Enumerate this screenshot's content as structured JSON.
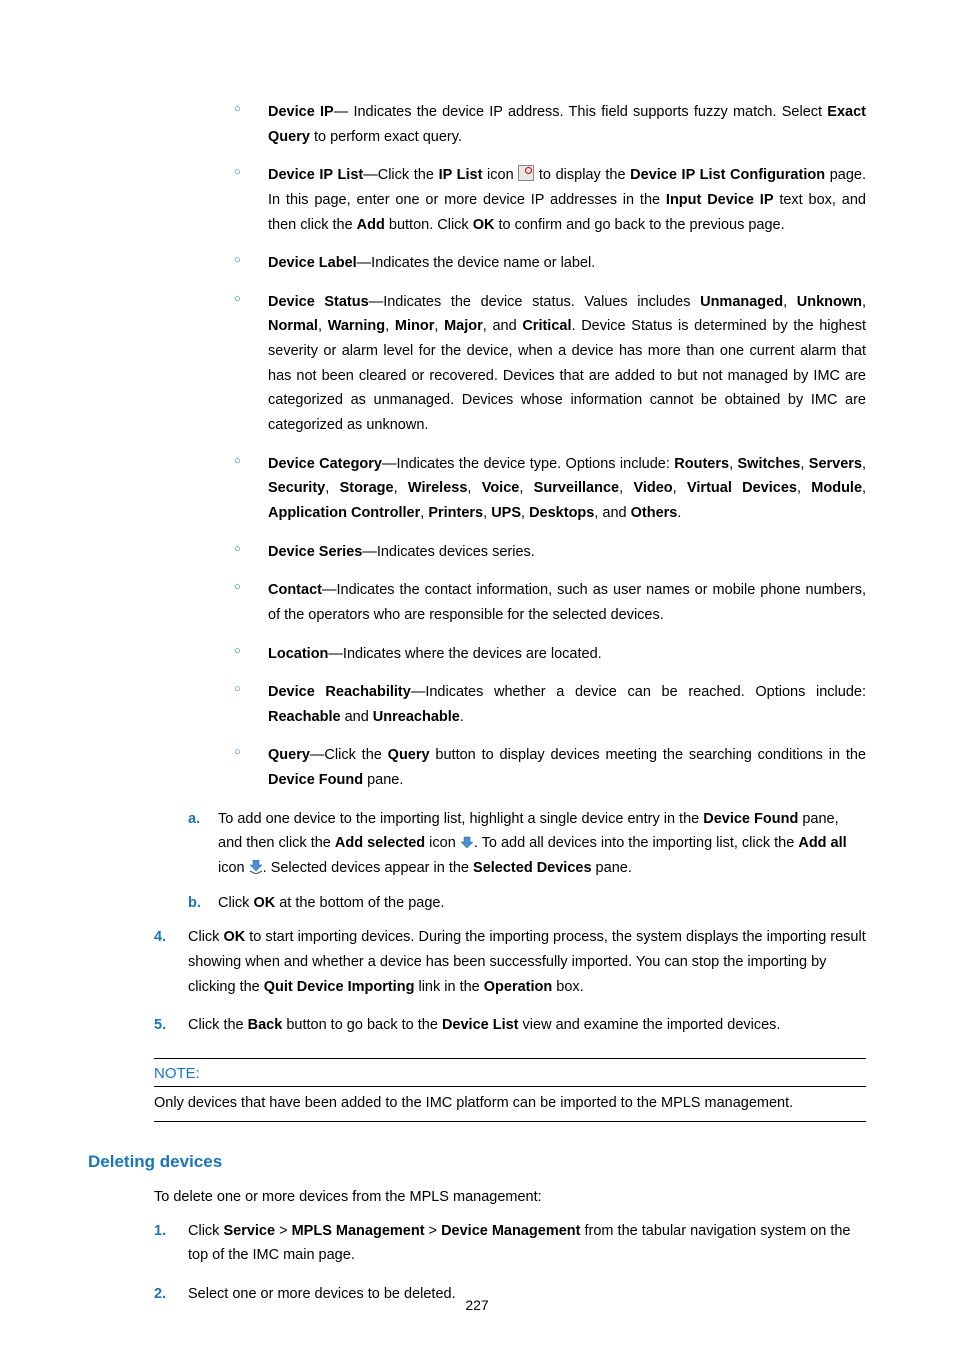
{
  "bullets": {
    "b1": {
      "term": "Device IP",
      "t1": "— Indicates the device IP address. This field supports fuzzy match. Select ",
      "bold1": "Exact Query",
      "t2": " to perform exact query."
    },
    "b2": {
      "term": "Device IP List",
      "t1": "—Click the ",
      "bold1": "IP List",
      "t2": " icon ",
      "t3": " to display the ",
      "bold2": "Device IP List Configuration",
      "t4": " page. In this page, enter one or more device IP addresses in the ",
      "bold3": "Input Device IP",
      "t5": " text box, and then click the ",
      "bold4": "Add",
      "t6": " button. Click ",
      "bold5": "OK",
      "t7": " to confirm and go back to the previous page."
    },
    "b3": {
      "term": "Device Label",
      "t1": "—Indicates the device name or label."
    },
    "b4": {
      "term": "Device Status",
      "t1": "—Indicates the device status. Values includes ",
      "bold1": "Unmanaged",
      "c1": ", ",
      "bold2": "Unknown",
      "c2": ", ",
      "bold3": "Normal",
      "c3": ", ",
      "bold4": "Warning",
      "c4": ", ",
      "bold5": "Minor",
      "c5": ", ",
      "bold6": "Major",
      "c6": ", and ",
      "bold7": "Critical",
      "t2": ". Device Status is determined by the highest severity or alarm level for the device, when a device has more than one current alarm that has not been cleared or recovered. Devices that are added to but not managed by IMC are categorized as unmanaged. Devices whose information cannot be obtained by IMC are categorized as unknown."
    },
    "b5": {
      "term": "Device Category",
      "t1": "—Indicates the device type. Options include: ",
      "bold1": "Routers",
      "c1": ", ",
      "bold2": "Switches",
      "c2": ", ",
      "bold3": "Servers",
      "c3": ", ",
      "bold4": "Security",
      "c4": ", ",
      "bold5": "Storage",
      "c5": ", ",
      "bold6": "Wireless",
      "c6": ", ",
      "bold7": "Voice",
      "c7": ", ",
      "bold8": "Surveillance",
      "c8": ", ",
      "bold9": "Video",
      "c9": ", ",
      "bold10": "Virtual Devices",
      "c10": ", ",
      "bold11": "Module",
      "c11": ", ",
      "bold12": "Application Controller",
      "c12": ", ",
      "bold13": "Printers",
      "c13": ", ",
      "bold14": "UPS",
      "c14": ", ",
      "bold15": "Desktops",
      "c15": ", and ",
      "bold16": "Others",
      "t2": "."
    },
    "b6": {
      "term": "Device Series",
      "t1": "—Indicates devices series."
    },
    "b7": {
      "term": "Contact",
      "t1": "—Indicates the contact information, such as user names or mobile phone numbers, of the operators who are responsible for the selected devices."
    },
    "b8": {
      "term": "Location",
      "t1": "—Indicates where the devices are located."
    },
    "b9": {
      "term": "Device Reachability",
      "t1": "—Indicates whether a device can be reached. Options include: ",
      "bold1": "Reachable",
      "c1": " and ",
      "bold2": "Unreachable",
      "t2": "."
    },
    "b10": {
      "term": "Query",
      "t1": "—Click the ",
      "bold1": "Query",
      "t2": " button to display devices meeting the searching conditions in the ",
      "bold2": "Device Found",
      "t3": " pane."
    }
  },
  "letters": {
    "a": {
      "marker": "a.",
      "t1": "To add one device to the importing list, highlight a single device entry in the ",
      "bold1": "Device Found",
      "t2": " pane, and then click the ",
      "bold2": "Add selected",
      "t3": " icon ",
      "t4": ". To add all devices into the importing list, click the ",
      "bold3": "Add all",
      "t5": " icon ",
      "t6": ". Selected devices appear in the ",
      "bold4": "Selected Devices",
      "t7": " pane."
    },
    "b": {
      "marker": "b.",
      "t1": "Click ",
      "bold1": "OK",
      "t2": " at the bottom of the page."
    }
  },
  "nums": {
    "n4": {
      "marker": "4.",
      "t1": "Click ",
      "bold1": "OK",
      "t2": " to start importing devices. During the importing process, the system displays the importing result showing when and whether a device has been successfully imported. You can stop the importing by clicking the ",
      "bold2": "Quit Device Importing",
      "t3": " link in the ",
      "bold3": "Operation",
      "t4": " box."
    },
    "n5": {
      "marker": "5.",
      "t1": "Click the ",
      "bold1": "Back",
      "t2": " button to go back to the ",
      "bold2": "Device List",
      "t3": " view and examine the imported devices."
    }
  },
  "note": {
    "head": "NOTE:",
    "body": "Only devices that have been added to the IMC platform can be imported to the MPLS management."
  },
  "heading": "Deleting devices",
  "deletePara": "To delete one or more devices from the MPLS management:",
  "delNums": {
    "d1": {
      "marker": "1.",
      "t1": "Click ",
      "bold1": "Service",
      "gt1": " > ",
      "bold2": "MPLS Management",
      "gt2": " > ",
      "bold3": "Device Management",
      "t2": " from the tabular navigation system on the top of the IMC main page."
    },
    "d2": {
      "marker": "2.",
      "t1": "Select one or more devices to be deleted."
    }
  },
  "pageNumber": "227"
}
